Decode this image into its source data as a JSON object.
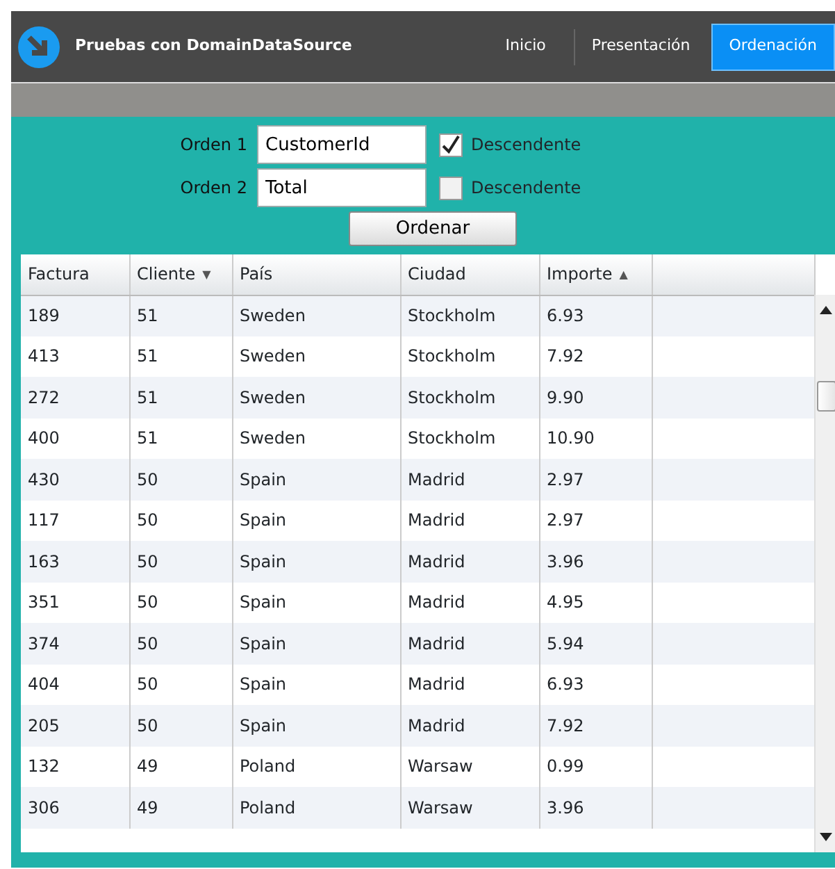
{
  "header": {
    "title": "Pruebas con DomainDataSource"
  },
  "nav": [
    {
      "label": "Inicio",
      "selected": false
    },
    {
      "label": "Presentación",
      "selected": false
    },
    {
      "label": "Ordenación",
      "selected": true
    }
  ],
  "sort_form": {
    "rows": [
      {
        "label": "Orden 1",
        "value": "CustomerId",
        "checkbox_label": "Descendente",
        "checked": true
      },
      {
        "label": "Orden 2",
        "value": "Total",
        "checkbox_label": "Descendente",
        "checked": false
      }
    ],
    "button": "Ordenar"
  },
  "table": {
    "columns": [
      {
        "label": "Factura"
      },
      {
        "label": "Cliente",
        "sort_arrow": "▼"
      },
      {
        "label": "País"
      },
      {
        "label": "Ciudad"
      },
      {
        "label": "Importe",
        "sort_arrow": "▲"
      }
    ],
    "rows": [
      [
        "189",
        "51",
        "Sweden",
        "Stockholm",
        "6.93"
      ],
      [
        "413",
        "51",
        "Sweden",
        "Stockholm",
        "7.92"
      ],
      [
        "272",
        "51",
        "Sweden",
        "Stockholm",
        "9.90"
      ],
      [
        "400",
        "51",
        "Sweden",
        "Stockholm",
        "10.90"
      ],
      [
        "430",
        "50",
        "Spain",
        "Madrid",
        "2.97"
      ],
      [
        "117",
        "50",
        "Spain",
        "Madrid",
        "2.97"
      ],
      [
        "163",
        "50",
        "Spain",
        "Madrid",
        "3.96"
      ],
      [
        "351",
        "50",
        "Spain",
        "Madrid",
        "4.95"
      ],
      [
        "374",
        "50",
        "Spain",
        "Madrid",
        "5.94"
      ],
      [
        "404",
        "50",
        "Spain",
        "Madrid",
        "6.93"
      ],
      [
        "205",
        "50",
        "Spain",
        "Madrid",
        "7.92"
      ],
      [
        "132",
        "49",
        "Poland",
        "Warsaw",
        "0.99"
      ],
      [
        "306",
        "49",
        "Poland",
        "Warsaw",
        "3.96"
      ]
    ]
  }
}
